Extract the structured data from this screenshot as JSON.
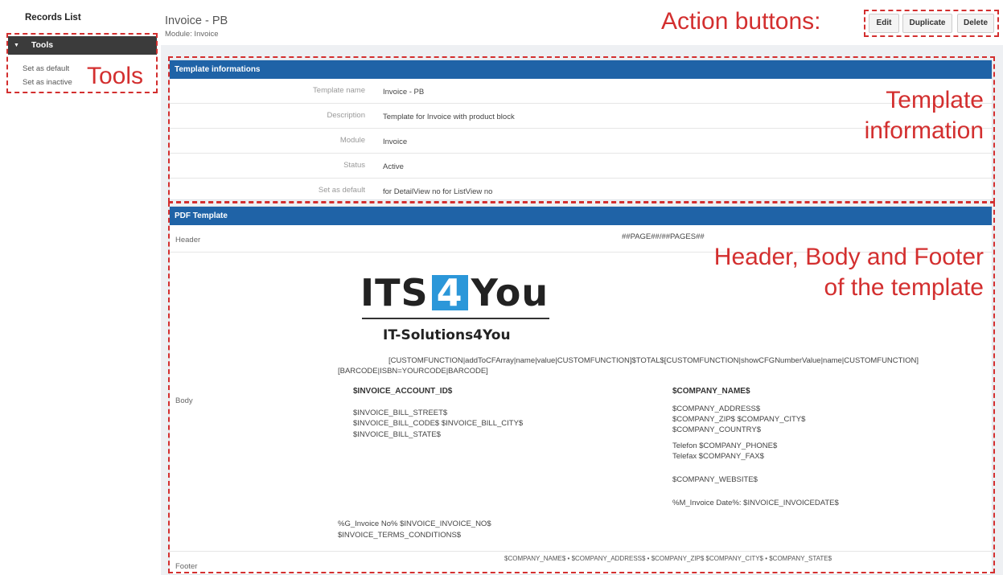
{
  "sidebar": {
    "title": "Records List",
    "tools": {
      "label": "Tools",
      "links": [
        "Set as default",
        "Set as inactive"
      ]
    }
  },
  "page": {
    "title": "Invoice - PB",
    "subtitle": "Module: Invoice"
  },
  "actions": {
    "edit": "Edit",
    "duplicate": "Duplicate",
    "delete": "Delete"
  },
  "template_info": {
    "heading": "Template informations",
    "rows": [
      {
        "label": "Template name",
        "value": "Invoice - PB"
      },
      {
        "label": "Description",
        "value": "Template for Invoice with product block"
      },
      {
        "label": "Module",
        "value": "Invoice"
      },
      {
        "label": "Status",
        "value": "Active"
      },
      {
        "label": "Set as default",
        "value": "for DetailView no  for ListView no"
      }
    ]
  },
  "pdf_template": {
    "heading": "PDF Template",
    "header_label": "Header",
    "header_code": "##PAGE##/##PAGES##",
    "body_label": "Body",
    "footer_label": "Footer",
    "logo": {
      "left": "ITS",
      "number": "4",
      "right": "You",
      "subtitle": "IT-Solutions4You"
    },
    "custom_function_line1": "[CUSTOMFUNCTION|addToCFArray|name|value|CUSTOMFUNCTION]$TOTAL$[CUSTOMFUNCTION|showCFGNumberValue|name|CUSTOMFUNCTION]",
    "custom_function_line2": "[BARCODE|ISBN=YOURCODE|BARCODE]",
    "account_id": "$INVOICE_ACCOUNT_ID$",
    "bill_street": "$INVOICE_BILL_STREET$",
    "bill_code_city": "$INVOICE_BILL_CODE$ $INVOICE_BILL_CITY$",
    "bill_state": "$INVOICE_BILL_STATE$",
    "company_name": "$COMPANY_NAME$",
    "company_address": "$COMPANY_ADDRESS$",
    "company_zip_city": "$COMPANY_ZIP$ $COMPANY_CITY$",
    "company_country": "$COMPANY_COUNTRY$",
    "company_phone": "Telefon $COMPANY_PHONE$",
    "company_fax": "Telefax $COMPANY_FAX$",
    "company_website": "$COMPANY_WEBSITE$",
    "invoice_date": "%M_Invoice Date%: $INVOICE_INVOICEDATE$",
    "invoice_no": "%G_Invoice No% $INVOICE_INVOICE_NO$",
    "terms": "$INVOICE_TERMS_CONDITIONS$",
    "footer_code": "$COMPANY_NAME$ • $COMPANY_ADDRESS$ • $COMPANY_ZIP$ $COMPANY_CITY$ • $COMPANY_STATE$"
  },
  "annotations": {
    "tools": "Tools",
    "action_buttons": "Action buttons:",
    "template_information_1": "Template",
    "template_information_2": "information",
    "hbf_1": "Header, Body and Footer",
    "hbf_2": "of the template"
  },
  "colors": {
    "panel_header": "#1f63a7",
    "sidebar_tools": "#3b3b3b",
    "annotation": "#d32f2f",
    "logo_accent": "#2b97d9"
  }
}
